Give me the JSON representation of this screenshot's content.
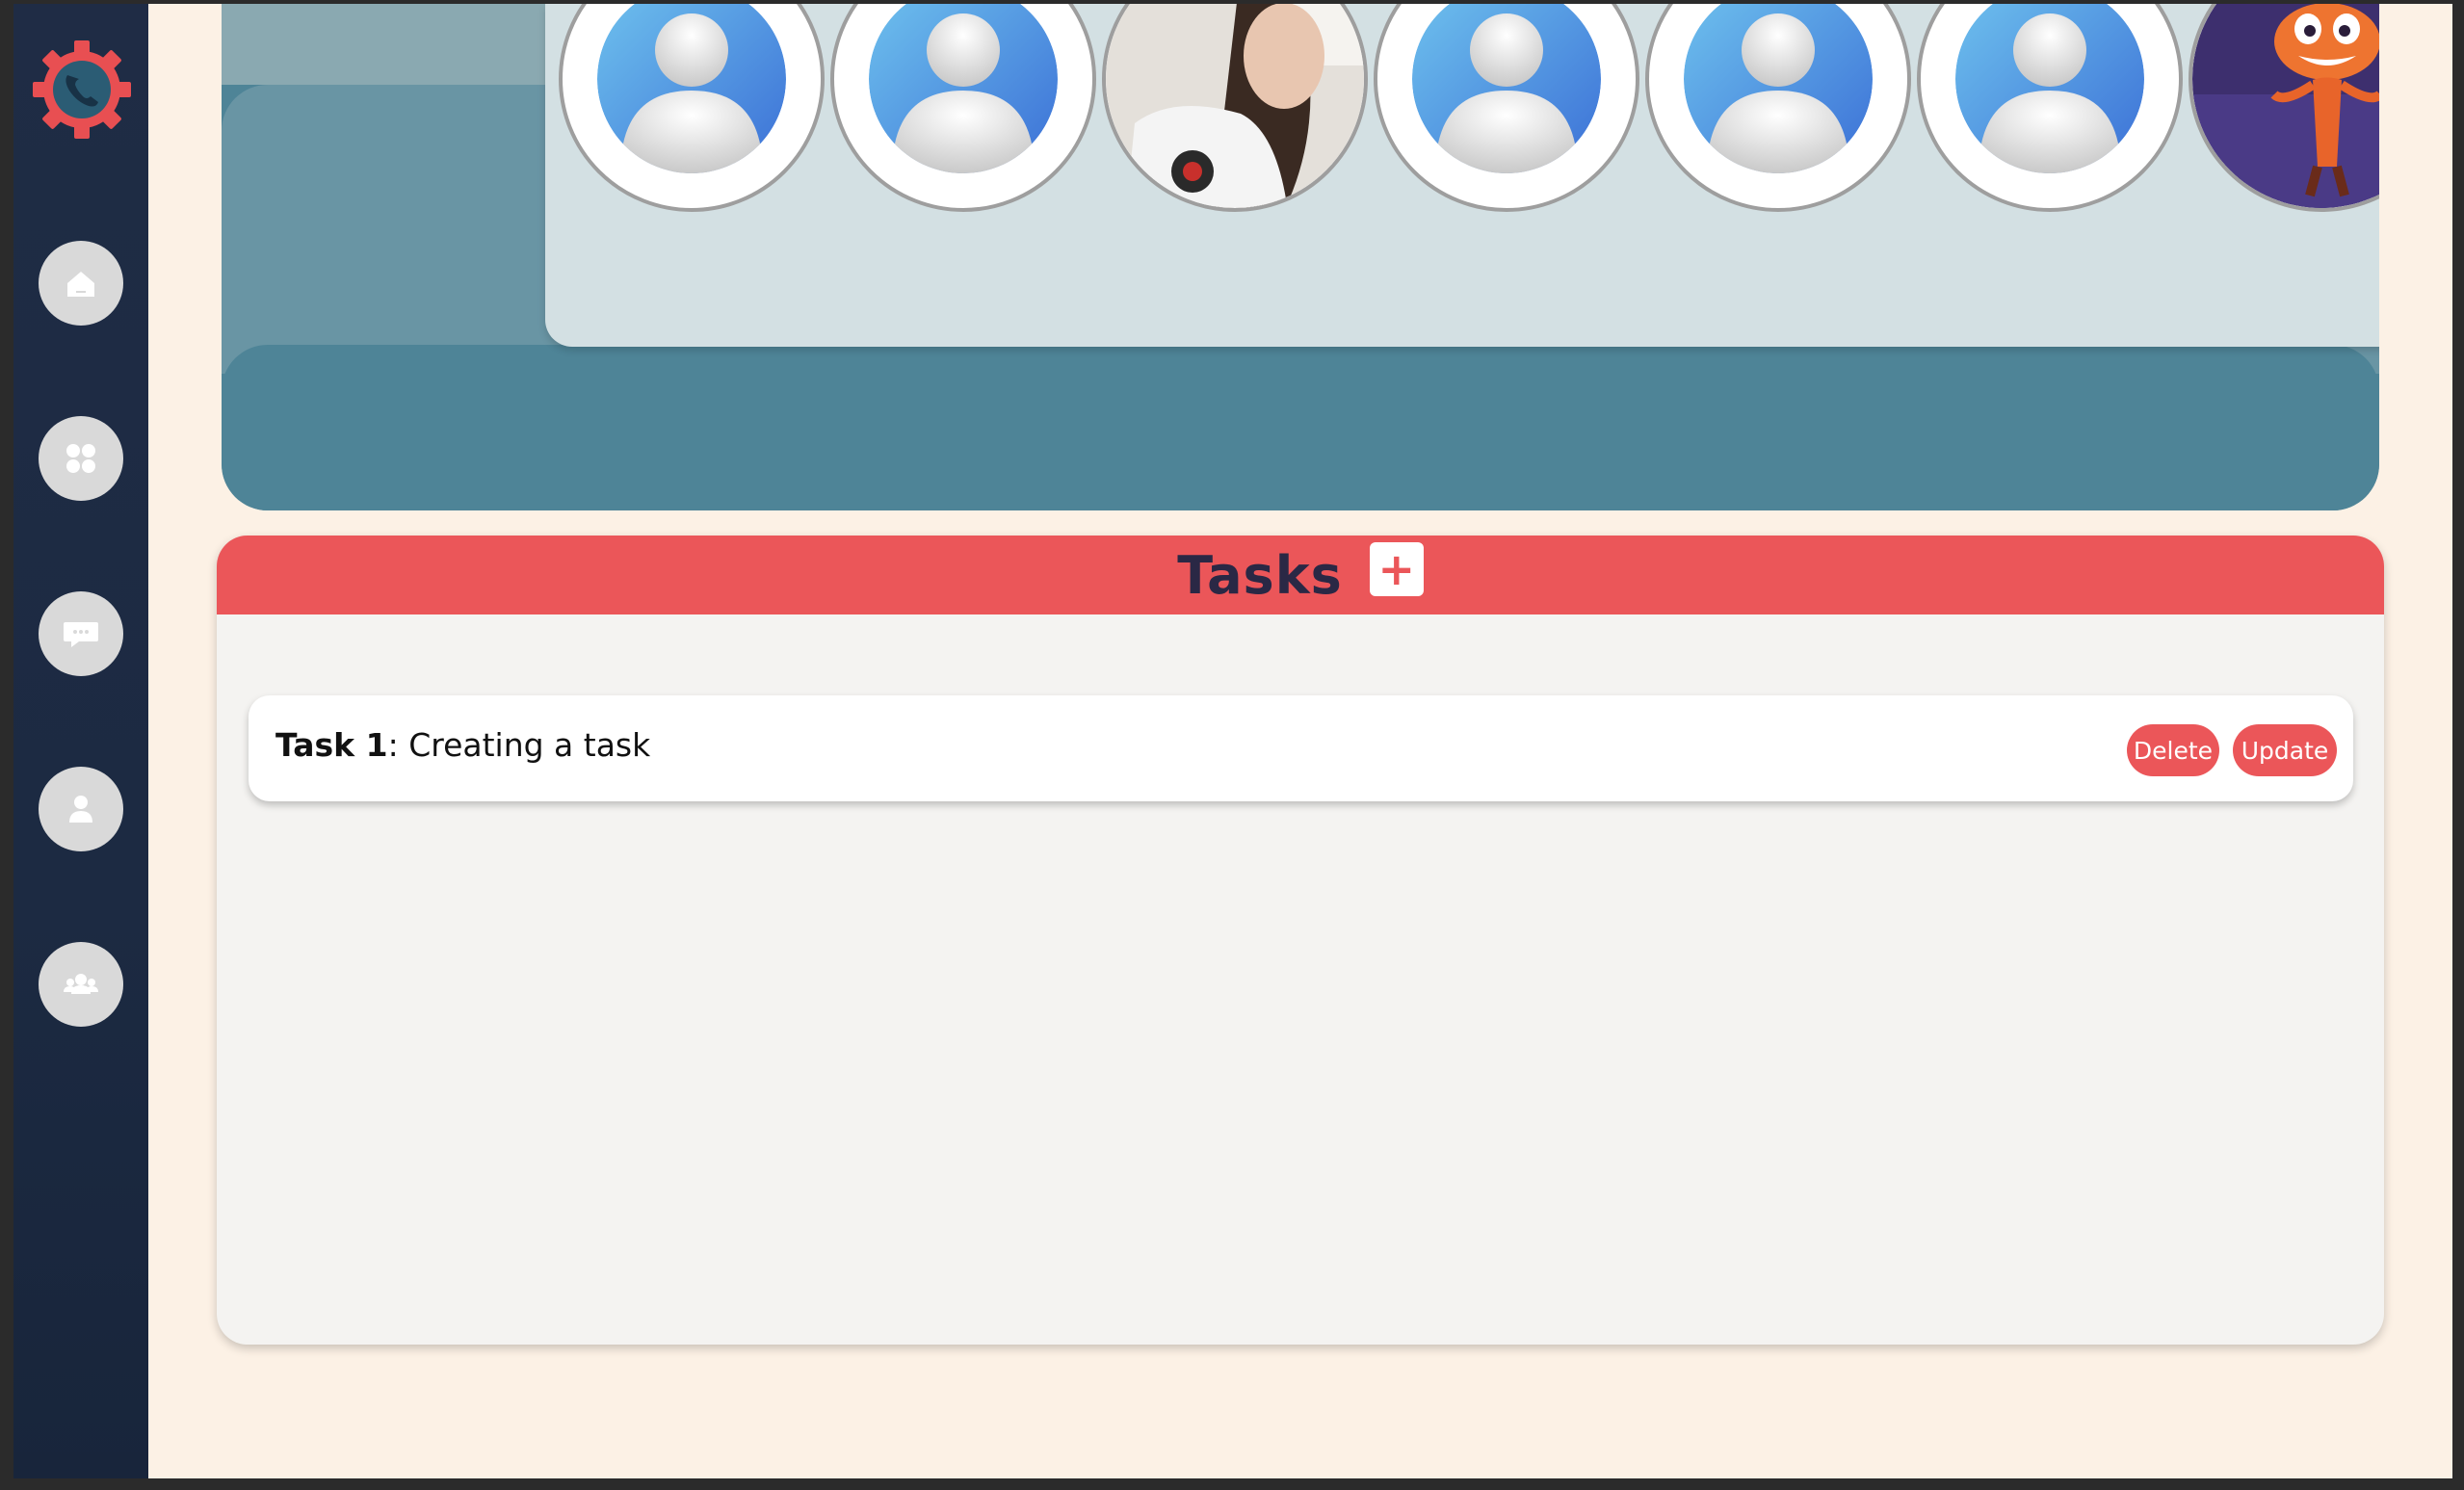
{
  "sidebar": {
    "logo_icon": "gear-phone-logo",
    "items": [
      {
        "icon": "home-icon"
      },
      {
        "icon": "apps-icon"
      },
      {
        "icon": "chat-icon"
      },
      {
        "icon": "user-icon"
      },
      {
        "icon": "team-icon"
      }
    ]
  },
  "members": [
    {
      "type": "placeholder"
    },
    {
      "type": "placeholder"
    },
    {
      "type": "photo",
      "icon": "user-photo-girl"
    },
    {
      "type": "placeholder"
    },
    {
      "type": "placeholder"
    },
    {
      "type": "placeholder"
    },
    {
      "type": "photo",
      "icon": "user-photo-cartoon"
    }
  ],
  "tasks": {
    "title": "Tasks",
    "add_label": "+",
    "items": [
      {
        "name": "Task 1",
        "separator": ":",
        "description": " Creating a task",
        "delete_label": "Delete",
        "update_label": "Update"
      }
    ]
  },
  "colors": {
    "accent": "#eb5659",
    "sidebar": "#1f2c45",
    "banner": "#4e8497",
    "background": "#fcf1e5"
  }
}
